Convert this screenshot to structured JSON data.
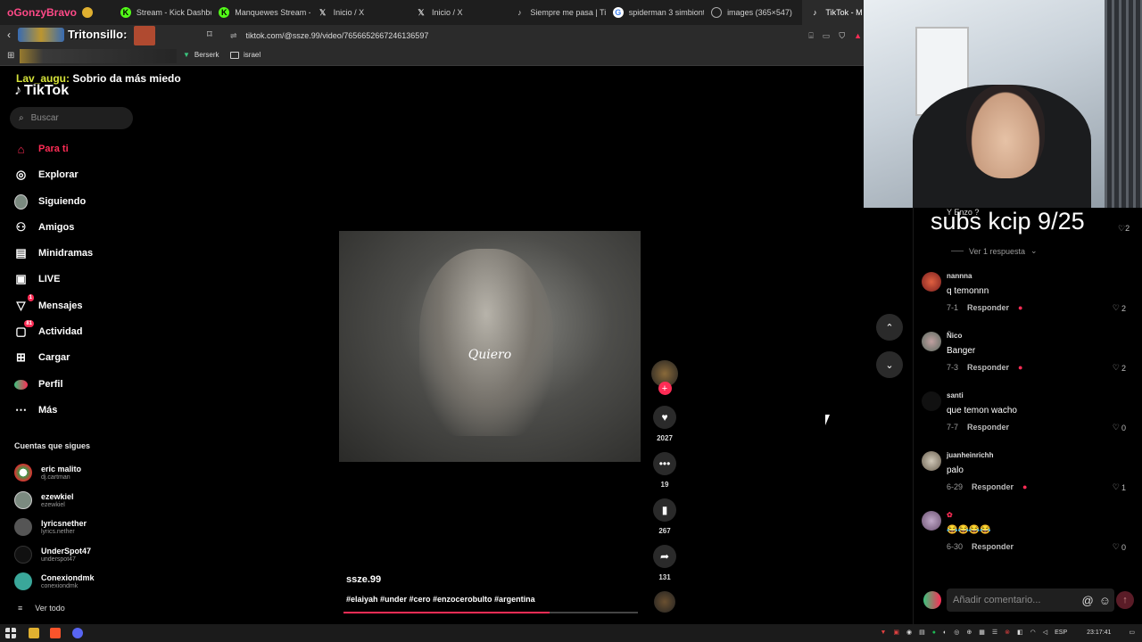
{
  "browser": {
    "tabs": [
      {
        "title": "oGonzyBravo",
        "icon": "streamer-avatar-icon"
      },
      {
        "title": "Stream - Kick Dashboard",
        "icon": "kick-icon"
      },
      {
        "title": "Manquewes Stream -",
        "icon": "kick-icon"
      },
      {
        "title": "Inicio / X",
        "icon": "x-icon"
      },
      {
        "title": "Inicio / X",
        "icon": "x-icon"
      },
      {
        "title": "Siempre me pasa | Tik",
        "icon": "tiktok-icon"
      },
      {
        "title": "spiderman 3 simbionte",
        "icon": "google-icon"
      },
      {
        "title": "images (365×547)",
        "icon": "globe-icon"
      },
      {
        "title": "TikTok - M",
        "icon": "tiktok-icon"
      }
    ],
    "url": "tiktok.com/@ssze.99/video/7656652667246136597",
    "bookmarks": [
      "Berserk",
      "israel"
    ],
    "overlay_name": "Tritonsillo:"
  },
  "overlay": {
    "chat_user": "Lav_augu:",
    "chat_message": "Sobrio da más miedo",
    "subs_goal": "subs kcip 9/25"
  },
  "tiktok": {
    "logo": "TikTok",
    "search_placeholder": "Buscar",
    "nav": [
      {
        "label": "Para ti",
        "icon": "home-icon",
        "active": true
      },
      {
        "label": "Explorar",
        "icon": "compass-icon"
      },
      {
        "label": "Siguiendo",
        "icon": "avatar-icon"
      },
      {
        "label": "Amigos",
        "icon": "friends-icon"
      },
      {
        "label": "Minidramas",
        "icon": "minidramas-icon"
      },
      {
        "label": "LIVE",
        "icon": "live-icon"
      },
      {
        "label": "Mensajes",
        "icon": "messages-icon",
        "badge": "1"
      },
      {
        "label": "Actividad",
        "icon": "activity-icon",
        "badge": "81"
      },
      {
        "label": "Cargar",
        "icon": "upload-icon"
      },
      {
        "label": "Perfil",
        "icon": "profile-icon"
      },
      {
        "label": "Más",
        "icon": "more-icon"
      }
    ],
    "follows_title": "Cuentas que sigues",
    "accounts": [
      {
        "name": "eric malito",
        "handle": "dj.cartman"
      },
      {
        "name": "ezewkiel",
        "handle": "ezewkiel"
      },
      {
        "name": "lyricsnether",
        "handle": "lyrics.nether"
      },
      {
        "name": "UnderSpot47",
        "handle": "underspot47"
      },
      {
        "name": "Conexiondmk",
        "handle": "conexiondmk"
      }
    ],
    "see_all": "Ver todo"
  },
  "video": {
    "caption_overlay": "Quiero",
    "author": "ssze.99",
    "hashtags": "#elaiyah #under #cero #enzocerobulto #argentina",
    "progress": 0.7,
    "likes": "2027",
    "comments": "19",
    "saves": "267",
    "shares": "131"
  },
  "comments": {
    "partial_text": "Y Enzo ?",
    "partial_likes": "2",
    "view_replies": "Ver 1 respuesta",
    "reply_label": "Responder",
    "items": [
      {
        "user": "nannna",
        "text": "q temonnn",
        "date": "7-1",
        "likes": "2"
      },
      {
        "user": "Ñico",
        "text": "Banger",
        "date": "7-3",
        "likes": "2"
      },
      {
        "user": "santi",
        "text": "que temon wacho",
        "date": "7-7",
        "likes": "0"
      },
      {
        "user": "juanheinrichh",
        "text": "palo",
        "date": "6-29",
        "likes": "1"
      },
      {
        "user": "",
        "text": "😂😂😂😂",
        "date": "6-30",
        "likes": "0"
      }
    ],
    "input_placeholder": "Añadir comentario..."
  },
  "taskbar": {
    "language": "ESP",
    "time": "23:17:41"
  },
  "colors": {
    "accent": "#fe2c55",
    "background": "#000000",
    "panel": "#1f1f1f"
  }
}
